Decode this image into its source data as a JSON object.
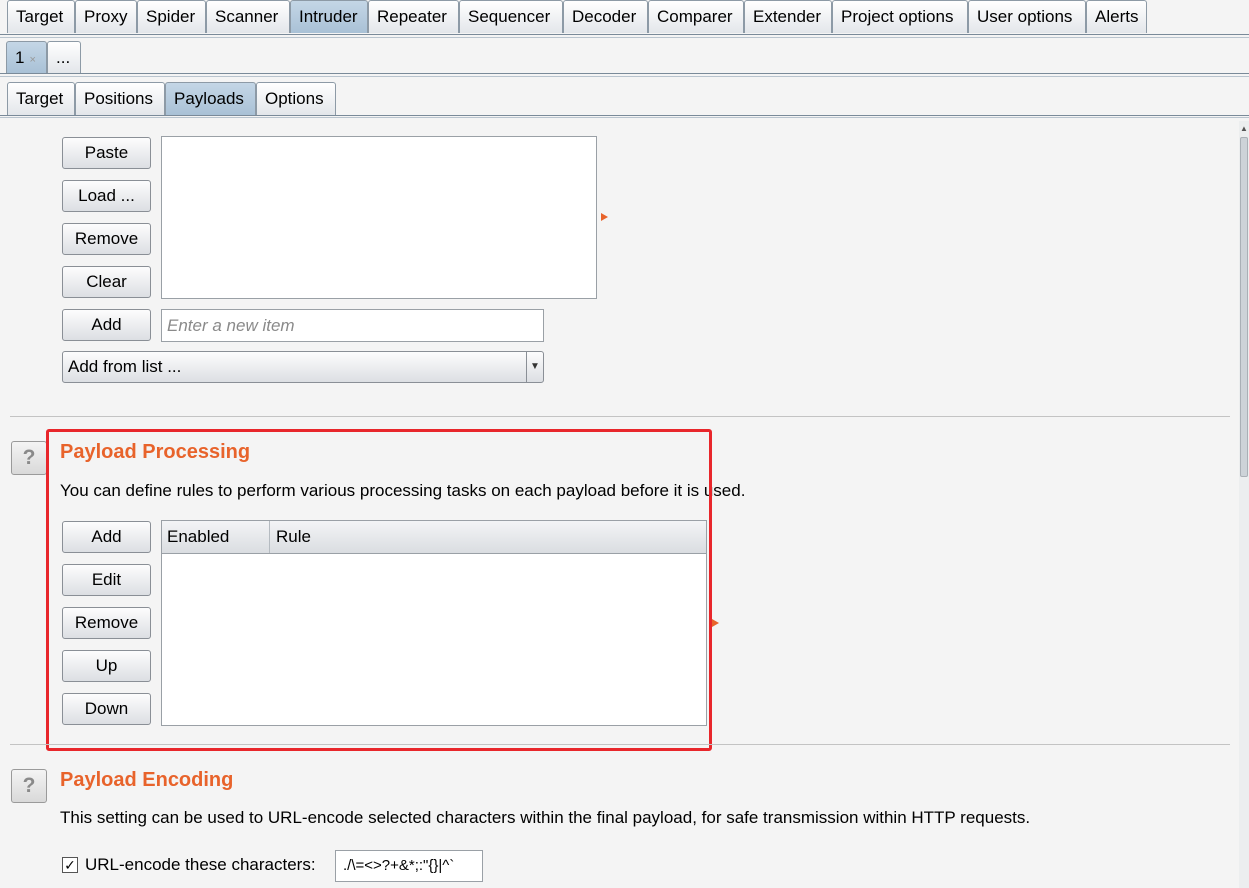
{
  "main_tabs": [
    "Target",
    "Proxy",
    "Spider",
    "Scanner",
    "Intruder",
    "Repeater",
    "Sequencer",
    "Decoder",
    "Comparer",
    "Extender",
    "Project options",
    "User options",
    "Alerts"
  ],
  "instance_tabs": {
    "current": "1",
    "close_symbol": "×",
    "more": "..."
  },
  "sub_tabs": [
    "Target",
    "Positions",
    "Payloads",
    "Options"
  ],
  "payload_list": {
    "buttons": {
      "paste": "Paste",
      "load": "Load ...",
      "remove": "Remove",
      "clear": "Clear",
      "add": "Add"
    },
    "new_item_placeholder": "Enter a new item",
    "add_from_list": "Add from list ..."
  },
  "payload_processing": {
    "title": "Payload Processing",
    "description": "You can define rules to perform various processing tasks on each payload before it is used.",
    "buttons": {
      "add": "Add",
      "edit": "Edit",
      "remove": "Remove",
      "up": "Up",
      "down": "Down"
    },
    "columns": [
      "Enabled",
      "Rule"
    ]
  },
  "payload_encoding": {
    "title": "Payload Encoding",
    "description": "This setting can be used to URL-encode selected characters within the final payload, for safe transmission within HTTP requests.",
    "checkbox_label": "URL-encode these characters:",
    "checkbox_checked": true,
    "characters": "./\\=<>?+&*;:\"{}|^`"
  },
  "colors": {
    "accent": "#e8632b",
    "highlight_box": "#e8262b",
    "selected_tab": "#b4c9dc"
  },
  "icons": {
    "help": "question-icon",
    "dropdown": "chevron-down-icon",
    "expand": "arrow-right-icon"
  }
}
